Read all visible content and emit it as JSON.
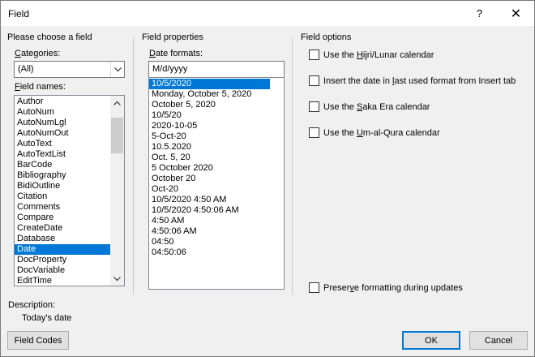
{
  "window": {
    "title": "Field",
    "help_glyph": "?",
    "close_glyph": "✕"
  },
  "choose_field": {
    "group_label": "Please choose a field",
    "categories_label": "Categories:",
    "categories_value": "(All)",
    "field_names_label": "Field names:",
    "field_names": [
      "Author",
      "AutoNum",
      "AutoNumLgl",
      "AutoNumOut",
      "AutoText",
      "AutoTextList",
      "BarCode",
      "Bibliography",
      "BidiOutline",
      "Citation",
      "Comments",
      "Compare",
      "CreateDate",
      "Database",
      "Date",
      "DocProperty",
      "DocVariable",
      "EditTime"
    ],
    "selected_field": "Date"
  },
  "field_properties": {
    "group_label": "Field properties",
    "date_formats_label": "Date formats:",
    "format_input": "M/d/yyyy",
    "date_formats": [
      "10/5/2020",
      "Monday, October 5, 2020",
      "October 5, 2020",
      "10/5/20",
      "2020-10-05",
      "5-Oct-20",
      "10.5.2020",
      "Oct. 5, 20",
      "5 October 2020",
      "October 20",
      "Oct-20",
      "10/5/2020 4:50 AM",
      "10/5/2020 4:50:06 AM",
      "4:50 AM",
      "4:50:06 AM",
      "04:50",
      "04:50:06"
    ],
    "selected_format": "10/5/2020"
  },
  "field_options": {
    "group_label": "Field options",
    "options": [
      {
        "pre": "Use the ",
        "key": "H",
        "post": "ijri/Lunar calendar",
        "checked": false
      },
      {
        "pre": "Insert the date in ",
        "key": "l",
        "post": "ast used format from Insert tab",
        "checked": false
      },
      {
        "pre": "Use the ",
        "key": "S",
        "post": "aka Era calendar",
        "checked": false
      },
      {
        "pre": "Use the ",
        "key": "U",
        "post": "m-al-Qura calendar",
        "checked": false
      }
    ],
    "preserve": {
      "pre": "Preser",
      "key": "v",
      "post": "e formatting during updates",
      "checked": false
    }
  },
  "description": {
    "label": "Description:",
    "text": "Today's date"
  },
  "buttons": {
    "field_codes": "Field Codes",
    "ok": "OK",
    "cancel": "Cancel"
  }
}
